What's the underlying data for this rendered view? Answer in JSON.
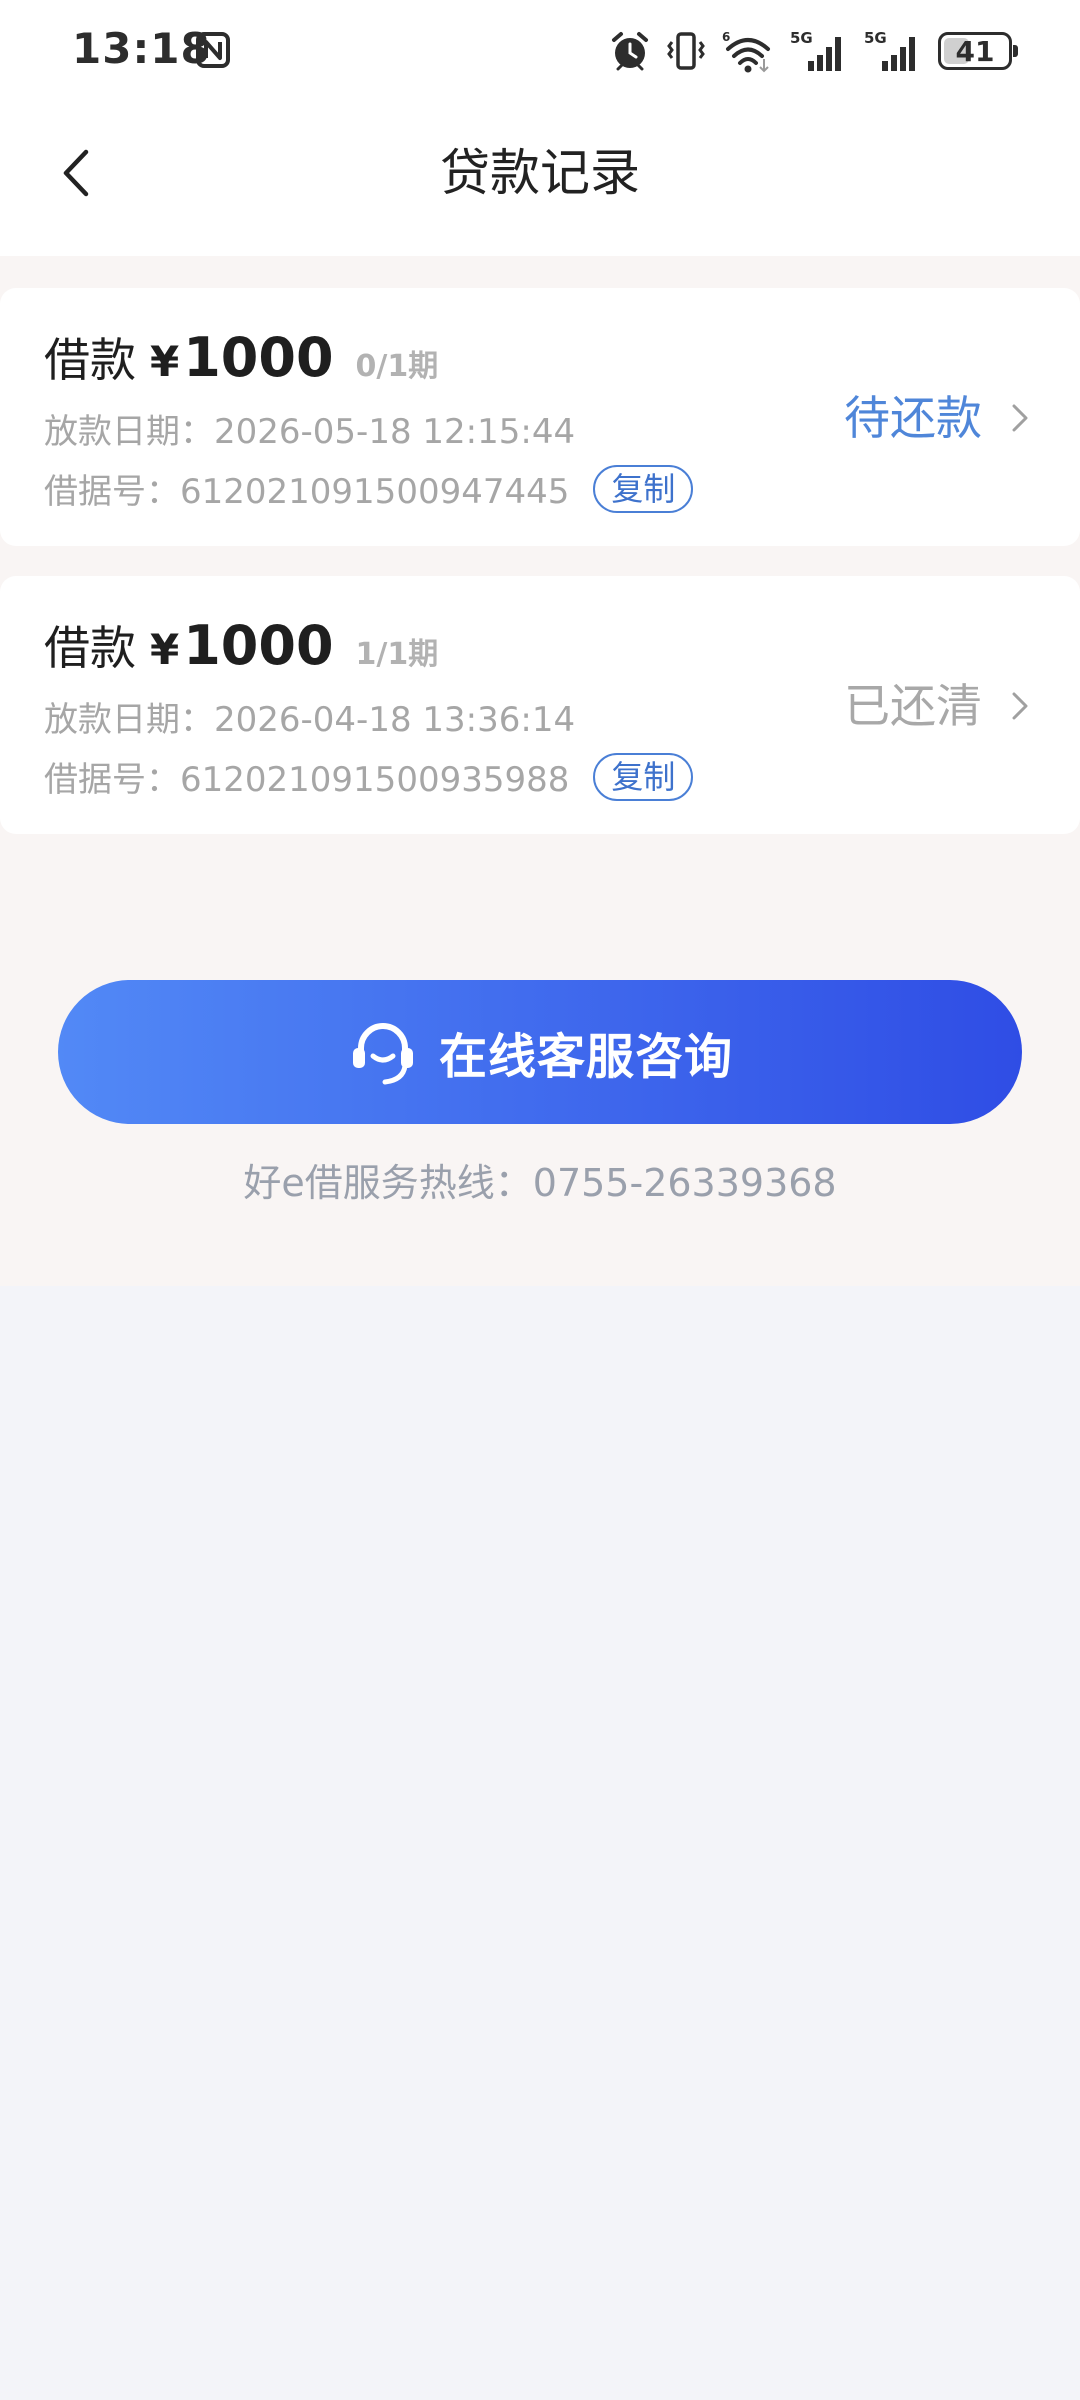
{
  "status_bar": {
    "time": "13:18",
    "battery": "41",
    "battery_level": 0.41
  },
  "header": {
    "title": "贷款记录"
  },
  "loans": [
    {
      "label": "借款",
      "currency": "¥",
      "amount": "1000",
      "period": "0/1期",
      "date": "放款日期：2026-05-18 12:15:44",
      "loan_no": "借据号：612021091500947445",
      "copy_label": "复制",
      "status": "待还款"
    },
    {
      "label": "借款",
      "currency": "¥",
      "amount": "1000",
      "period": "1/1期",
      "date": "放款日期：2026-04-18 13:36:14",
      "loan_no": "借据号：612021091500935988",
      "copy_label": "复制",
      "status": "已还清"
    }
  ],
  "service": {
    "button_label": "在线客服咨询",
    "hotline": "好e借服务热线：0755-26339368"
  },
  "colors": {
    "accent_blue": "#4f86d9",
    "button_gradient_start": "#5289f6",
    "button_gradient_end": "#2f4de5",
    "muted_text": "#a6a6a6"
  },
  "icons": [
    "nfc-icon",
    "alarm-icon",
    "vibrate-icon",
    "wifi-icon",
    "signal-icon",
    "battery-icon",
    "back-arrow-icon",
    "chevron-right-icon",
    "headset-icon"
  ]
}
